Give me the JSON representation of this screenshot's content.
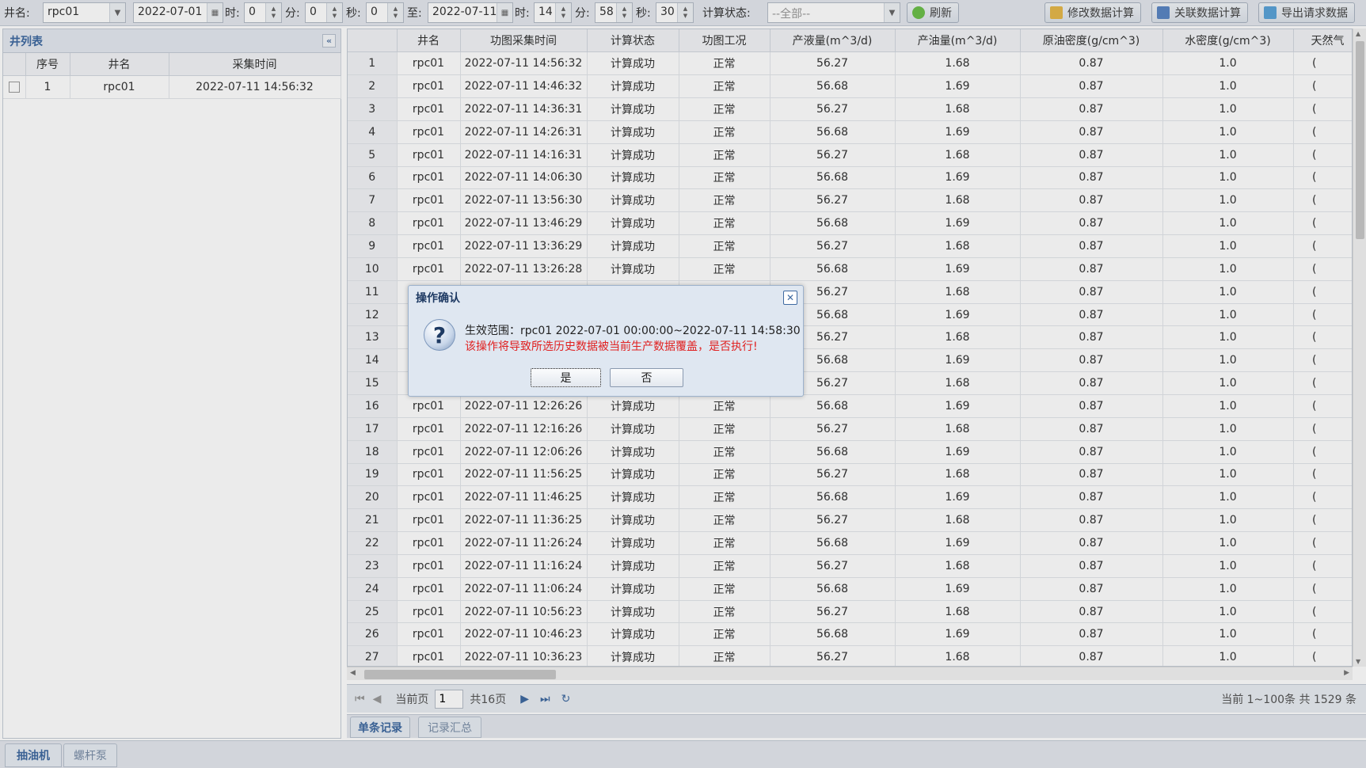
{
  "toolbar": {
    "well_label": "井名:",
    "well_value": "rpc01",
    "start_date": "2022-07-01",
    "hour_label": "时:",
    "start_hour": "0",
    "minute_label": "分:",
    "start_minute": "0",
    "second_label": "秒:",
    "start_second": "0",
    "to_label": "至:",
    "end_date": "2022-07-11",
    "end_hour": "14",
    "end_minute": "58",
    "end_second": "30",
    "calc_status_label": "计算状态:",
    "calc_status_value": "--全部--",
    "refresh_label": "刷新",
    "modify_calc_label": "修改数据计算",
    "link_calc_label": "关联数据计算",
    "export_label": "导出请求数据"
  },
  "left_panel": {
    "title": "井列表",
    "columns": [
      "序号",
      "井名",
      "采集时间"
    ],
    "rows": [
      {
        "no": "1",
        "well": "rpc01",
        "time": "2022-07-11 14:56:32"
      }
    ]
  },
  "grid": {
    "columns": [
      "井名",
      "功图采集时间",
      "计算状态",
      "功图工况",
      "产液量(m^3/d)",
      "产油量(m^3/d)",
      "原油密度(g/cm^3)",
      "水密度(g/cm^3)",
      "天然气"
    ],
    "rows": [
      [
        "1",
        "rpc01",
        "2022-07-11 14:56:32",
        "计算成功",
        "正常",
        "56.27",
        "1.68",
        "0.87",
        "1.0",
        "("
      ],
      [
        "2",
        "rpc01",
        "2022-07-11 14:46:32",
        "计算成功",
        "正常",
        "56.68",
        "1.69",
        "0.87",
        "1.0",
        "("
      ],
      [
        "3",
        "rpc01",
        "2022-07-11 14:36:31",
        "计算成功",
        "正常",
        "56.27",
        "1.68",
        "0.87",
        "1.0",
        "("
      ],
      [
        "4",
        "rpc01",
        "2022-07-11 14:26:31",
        "计算成功",
        "正常",
        "56.68",
        "1.69",
        "0.87",
        "1.0",
        "("
      ],
      [
        "5",
        "rpc01",
        "2022-07-11 14:16:31",
        "计算成功",
        "正常",
        "56.27",
        "1.68",
        "0.87",
        "1.0",
        "("
      ],
      [
        "6",
        "rpc01",
        "2022-07-11 14:06:30",
        "计算成功",
        "正常",
        "56.68",
        "1.69",
        "0.87",
        "1.0",
        "("
      ],
      [
        "7",
        "rpc01",
        "2022-07-11 13:56:30",
        "计算成功",
        "正常",
        "56.27",
        "1.68",
        "0.87",
        "1.0",
        "("
      ],
      [
        "8",
        "rpc01",
        "2022-07-11 13:46:29",
        "计算成功",
        "正常",
        "56.68",
        "1.69",
        "0.87",
        "1.0",
        "("
      ],
      [
        "9",
        "rpc01",
        "2022-07-11 13:36:29",
        "计算成功",
        "正常",
        "56.27",
        "1.68",
        "0.87",
        "1.0",
        "("
      ],
      [
        "10",
        "rpc01",
        "2022-07-11 13:26:28",
        "计算成功",
        "正常",
        "56.68",
        "1.69",
        "0.87",
        "1.0",
        "("
      ],
      [
        "11",
        "",
        "",
        "",
        "",
        "56.27",
        "1.68",
        "0.87",
        "1.0",
        "("
      ],
      [
        "12",
        "",
        "",
        "",
        "",
        "56.68",
        "1.69",
        "0.87",
        "1.0",
        "("
      ],
      [
        "13",
        "",
        "",
        "",
        "",
        "56.27",
        "1.68",
        "0.87",
        "1.0",
        "("
      ],
      [
        "14",
        "",
        "",
        "",
        "",
        "56.68",
        "1.69",
        "0.87",
        "1.0",
        "("
      ],
      [
        "15",
        "",
        "",
        "",
        "",
        "56.27",
        "1.68",
        "0.87",
        "1.0",
        "("
      ],
      [
        "16",
        "rpc01",
        "2022-07-11 12:26:26",
        "计算成功",
        "正常",
        "56.68",
        "1.69",
        "0.87",
        "1.0",
        "("
      ],
      [
        "17",
        "rpc01",
        "2022-07-11 12:16:26",
        "计算成功",
        "正常",
        "56.27",
        "1.68",
        "0.87",
        "1.0",
        "("
      ],
      [
        "18",
        "rpc01",
        "2022-07-11 12:06:26",
        "计算成功",
        "正常",
        "56.68",
        "1.69",
        "0.87",
        "1.0",
        "("
      ],
      [
        "19",
        "rpc01",
        "2022-07-11 11:56:25",
        "计算成功",
        "正常",
        "56.27",
        "1.68",
        "0.87",
        "1.0",
        "("
      ],
      [
        "20",
        "rpc01",
        "2022-07-11 11:46:25",
        "计算成功",
        "正常",
        "56.68",
        "1.69",
        "0.87",
        "1.0",
        "("
      ],
      [
        "21",
        "rpc01",
        "2022-07-11 11:36:25",
        "计算成功",
        "正常",
        "56.27",
        "1.68",
        "0.87",
        "1.0",
        "("
      ],
      [
        "22",
        "rpc01",
        "2022-07-11 11:26:24",
        "计算成功",
        "正常",
        "56.68",
        "1.69",
        "0.87",
        "1.0",
        "("
      ],
      [
        "23",
        "rpc01",
        "2022-07-11 11:16:24",
        "计算成功",
        "正常",
        "56.27",
        "1.68",
        "0.87",
        "1.0",
        "("
      ],
      [
        "24",
        "rpc01",
        "2022-07-11 11:06:24",
        "计算成功",
        "正常",
        "56.68",
        "1.69",
        "0.87",
        "1.0",
        "("
      ],
      [
        "25",
        "rpc01",
        "2022-07-11 10:56:23",
        "计算成功",
        "正常",
        "56.27",
        "1.68",
        "0.87",
        "1.0",
        "("
      ],
      [
        "26",
        "rpc01",
        "2022-07-11 10:46:23",
        "计算成功",
        "正常",
        "56.68",
        "1.69",
        "0.87",
        "1.0",
        "("
      ],
      [
        "27",
        "rpc01",
        "2022-07-11 10:36:23",
        "计算成功",
        "正常",
        "56.27",
        "1.68",
        "0.87",
        "1.0",
        "("
      ]
    ]
  },
  "pager": {
    "current_page_label": "当前页",
    "current_page": "1",
    "total_pages": "共16页",
    "summary": "当前 1~100条 共 1529 条"
  },
  "detail_tabs": [
    "单条记录",
    "记录汇总"
  ],
  "bottom_tabs": [
    "抽油机",
    "螺杆泵"
  ],
  "dialog": {
    "title": "操作确认",
    "scope_text": "生效范围：rpc01 2022-07-01 00:00:00~2022-07-11 14:58:30",
    "warning_text": "该操作将导致所选历史数据被当前生产数据覆盖，是否执行!",
    "yes_label": "是",
    "no_label": "否"
  },
  "colors": {
    "accent": "#3f6aa1",
    "warning": "#e02020"
  }
}
